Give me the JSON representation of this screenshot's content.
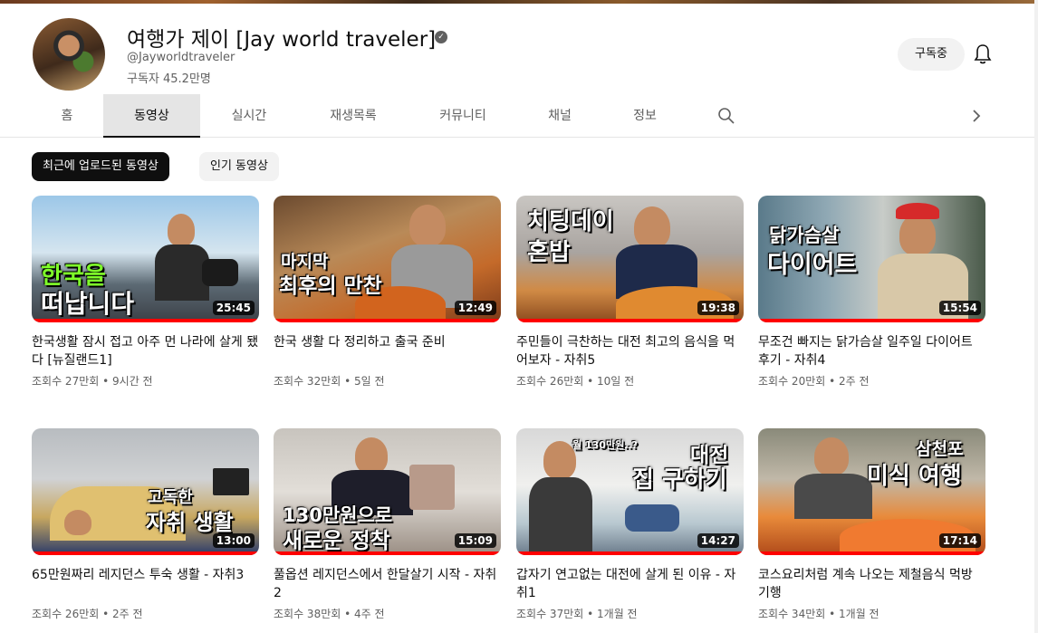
{
  "channel": {
    "name": "여행가 제이 [Jay world traveler]",
    "handle": "@Jayworldtraveler",
    "subscribers": "구독자 45.2만명",
    "subscribe_label": "구독중"
  },
  "tabs": [
    {
      "label": "홈"
    },
    {
      "label": "동영상"
    },
    {
      "label": "실시간"
    },
    {
      "label": "재생목록"
    },
    {
      "label": "커뮤니티"
    },
    {
      "label": "채널"
    },
    {
      "label": "정보"
    }
  ],
  "chips": [
    {
      "label": "최근에 업로드된 동영상"
    },
    {
      "label": "인기 동영상"
    }
  ],
  "videos": [
    {
      "title": "한국생활 잠시 접고 아주 먼 나라에 살게 됐다 [뉴질랜드1]",
      "views": "조회수 27만회",
      "age": "9시간 전",
      "duration": "25:45",
      "overlay": [
        "한국을",
        "떠납니다"
      ]
    },
    {
      "title": "한국 생활 다 정리하고 출국 준비",
      "views": "조회수 32만회",
      "age": "5일 전",
      "duration": "12:49",
      "overlay": [
        "마지막",
        "최후의 만찬"
      ]
    },
    {
      "title": "주민들이 극찬하는 대전 최고의 음식을 먹어보자 - 자취5",
      "views": "조회수 26만회",
      "age": "10일 전",
      "duration": "19:38",
      "overlay": [
        "치팅데이",
        "혼밥"
      ]
    },
    {
      "title": "무조건 빠지는 닭가슴살 일주일 다이어트 후기 - 자취4",
      "views": "조회수 20만회",
      "age": "2주 전",
      "duration": "15:54",
      "overlay": [
        "닭가슴살",
        "다이어트"
      ]
    },
    {
      "title": "65만원짜리 레지던스 투숙 생활 - 자취3",
      "views": "조회수 26만회",
      "age": "2주 전",
      "duration": "13:00",
      "overlay": [
        "고독한",
        "자취 생활"
      ]
    },
    {
      "title": "풀옵션 레지던스에서 한달살기 시작 - 자취2",
      "views": "조회수 38만회",
      "age": "4주 전",
      "duration": "15:09",
      "overlay": [
        "130만원으로",
        "새로운 정착"
      ]
    },
    {
      "title": "갑자기 연고없는 대전에 살게 된 이유 - 자취1",
      "views": "조회수 37만회",
      "age": "1개월 전",
      "duration": "14:27",
      "overlay": [
        "대전",
        "집 구하기"
      ]
    },
    {
      "title": "코스요리처럼 계속 나오는 제철음식 먹방 기행",
      "views": "조회수 34만회",
      "age": "1개월 전",
      "duration": "17:14",
      "overlay": [
        "삼천포",
        "미식 여행"
      ]
    }
  ],
  "meta_separator": "•",
  "icons": {
    "verified": "verified-check-icon",
    "bell": "bell-icon",
    "search": "search-icon",
    "chevron": "chevron-right-icon"
  },
  "colors": {
    "progress": "#ff0000",
    "chip_active": "#0f0f0f",
    "overlay_green": "#7fff2a"
  }
}
